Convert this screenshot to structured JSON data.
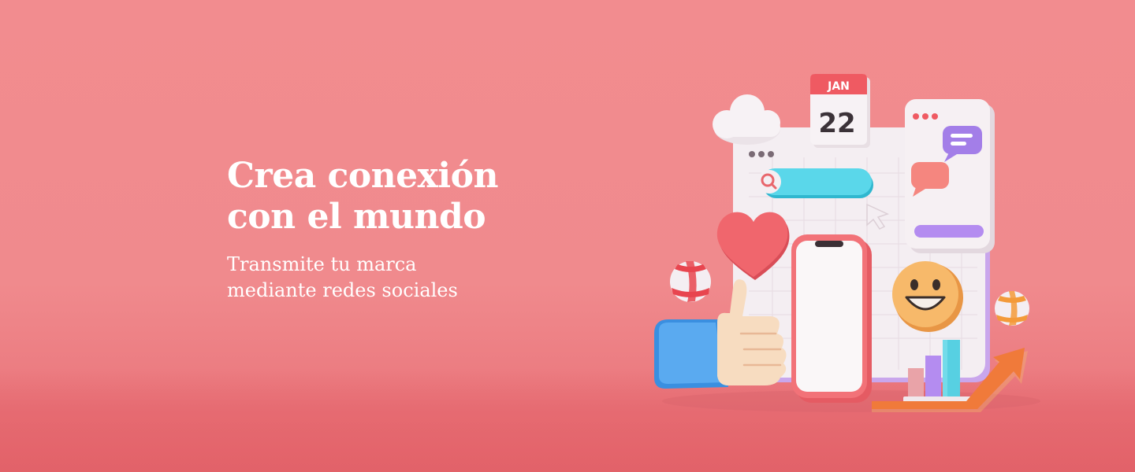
{
  "hero": {
    "headline_line1": "Crea conexión",
    "headline_line2": "con el mundo",
    "subline_line1": "Transmite tu marca",
    "subline_line2": "mediante redes sociales"
  },
  "illustration": {
    "calendar_month": "JAN",
    "calendar_day": "22",
    "icons": [
      "cloud-icon",
      "calendar-icon",
      "browser-window",
      "search-bar",
      "chat-bubble-icon",
      "heart-icon",
      "smartphone",
      "smiley-icon",
      "thumbs-up-icon",
      "beach-ball-icon",
      "bar-chart-icon",
      "growth-arrow-icon",
      "cursor-icon"
    ]
  },
  "colors": {
    "background": "#f28c8f",
    "text": "#ffffff",
    "accent_cyan": "#4fd3e6",
    "accent_purple": "#b28ff0",
    "accent_coral": "#f06a6f",
    "accent_yellow": "#f7b96a"
  }
}
